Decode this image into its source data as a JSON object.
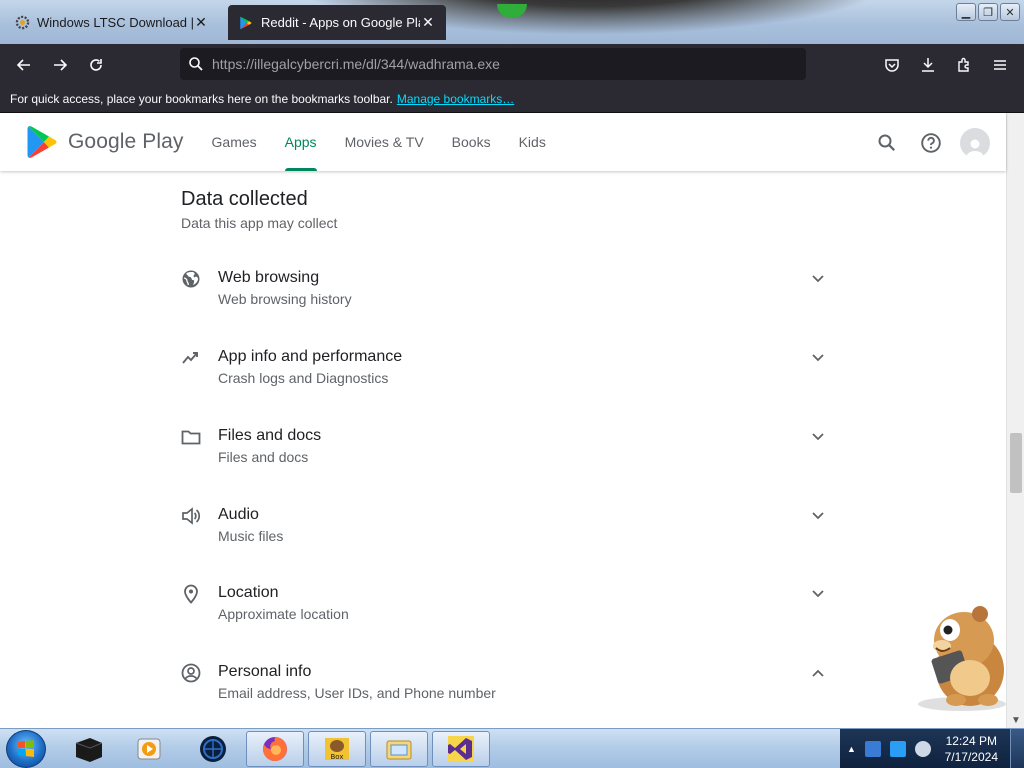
{
  "browser": {
    "tabs": [
      {
        "label": "Windows LTSC Download | MAS",
        "active": false
      },
      {
        "label": "Reddit - Apps on Google Play",
        "active": true
      }
    ],
    "url": {
      "host": "https://illegalcybercri.me",
      "path": "/dl/344/wadhrama.exe"
    },
    "bookmarks_bar": {
      "text": "For quick access, place your bookmarks here on the bookmarks toolbar.",
      "link": "Manage bookmarks…"
    }
  },
  "play": {
    "logo_text": "Google Play",
    "nav": [
      "Games",
      "Apps",
      "Movies & TV",
      "Books",
      "Kids"
    ],
    "active_nav": "Apps"
  },
  "data_safety": {
    "title": "Data collected",
    "subtitle": "Data this app may collect",
    "items": [
      {
        "title": "Web browsing",
        "subtitle": "Web browsing history",
        "icon": "globe-icon",
        "expanded": false
      },
      {
        "title": "App info and performance",
        "subtitle": "Crash logs and Diagnostics",
        "icon": "trend-icon",
        "expanded": false
      },
      {
        "title": "Files and docs",
        "subtitle": "Files and docs",
        "icon": "folder-icon",
        "expanded": false
      },
      {
        "title": "Audio",
        "subtitle": "Music files",
        "icon": "speaker-icon",
        "expanded": false
      },
      {
        "title": "Location",
        "subtitle": "Approximate location",
        "icon": "location-pin-icon",
        "expanded": false
      },
      {
        "title": "Personal info",
        "subtitle": "Email address, User IDs, and Phone number",
        "icon": "account-circle-icon",
        "expanded": true
      }
    ]
  },
  "taskbar": {
    "clock_time": "12:24 PM",
    "clock_date": "7/17/2024"
  },
  "colors": {
    "accent_green": "#01875f",
    "browser_dark": "#2b2a33",
    "link_cyan": "#00ddff"
  }
}
